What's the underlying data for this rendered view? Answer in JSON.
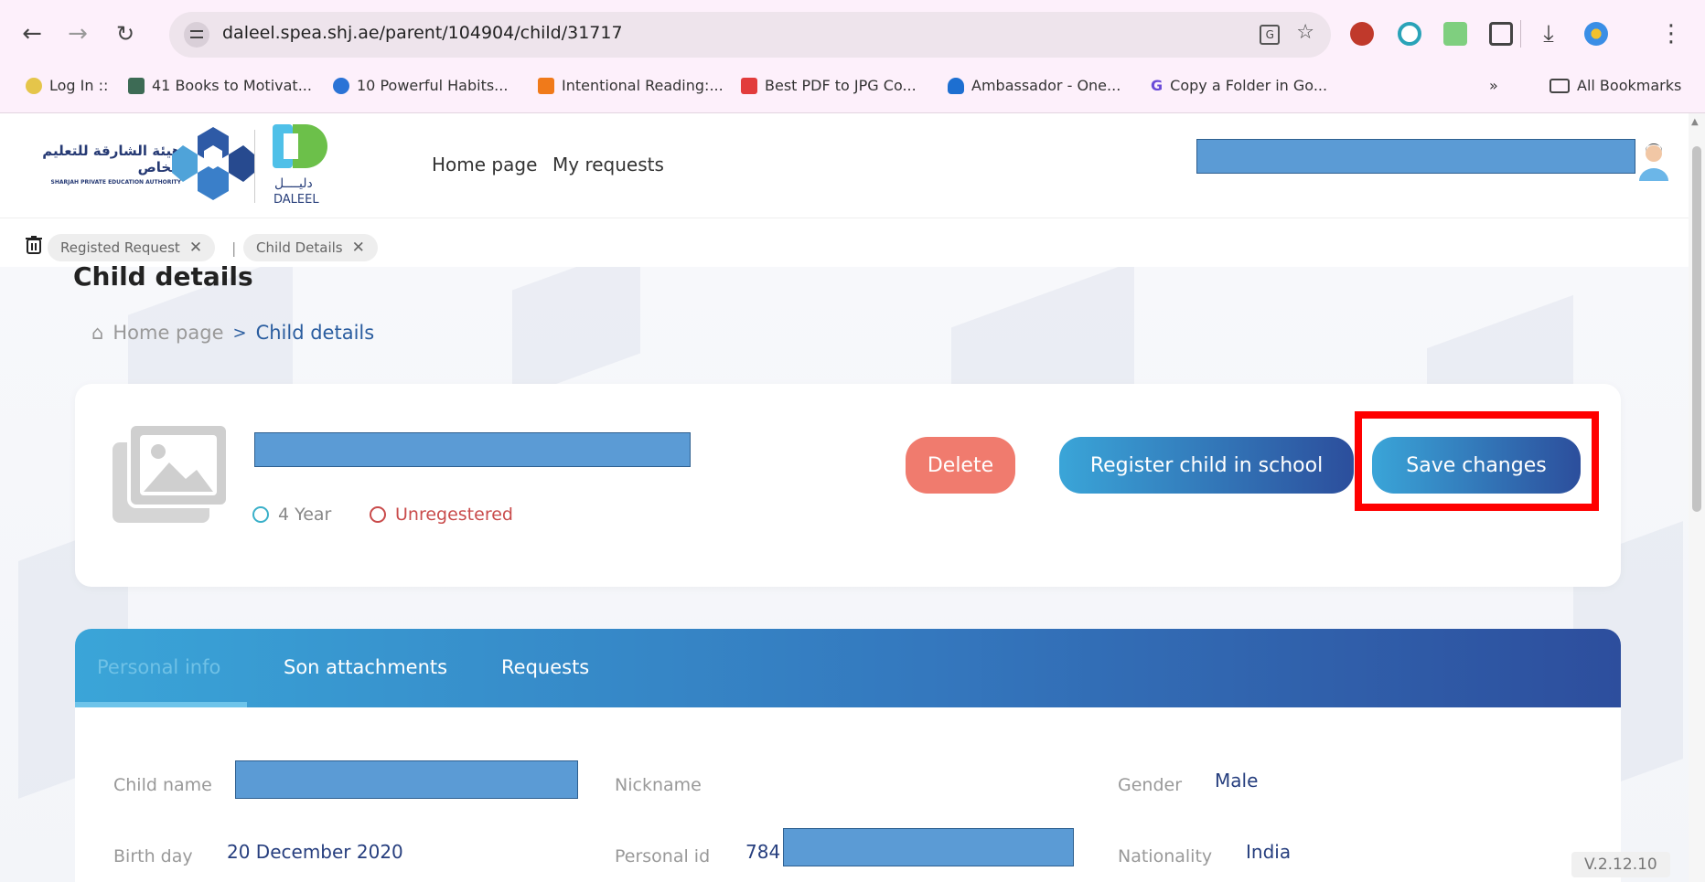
{
  "browser": {
    "url": "daleel.spea.shj.ae/parent/104904/child/31717",
    "bookmarks": [
      "Log In ::",
      "41 Books to Motivat...",
      "10 Powerful Habits...",
      "Intentional Reading:...",
      "Best PDF to JPG Co...",
      "Ambassador - One...",
      "Copy a Folder in Go..."
    ],
    "more_bookmarks": "»",
    "all_bookmarks": "All Bookmarks"
  },
  "header": {
    "spea_arabic": "هيئة الشارقة للتعليم الخاص",
    "spea_english": "SHARJAH PRIVATE EDUCATION AUTHORITY",
    "daleel_arabic": "دليــــل",
    "daleel_english": "DALEEL",
    "nav": [
      "Home page",
      "My requests"
    ]
  },
  "tabs": {
    "items": [
      "Registed Request",
      "Child Details"
    ],
    "separator": "|",
    "close": "✕"
  },
  "page": {
    "title": "Child details",
    "breadcrumb_home": "Home page",
    "breadcrumb_sep": ">",
    "breadcrumb_current": "Child details"
  },
  "child_card": {
    "age": "4 Year",
    "status": "Unregestered",
    "status_color": "#c94b4b",
    "buttons": {
      "delete": "Delete",
      "register": "Register child in school",
      "save": "Save changes"
    }
  },
  "info_tabs": [
    "Personal info",
    "Son attachments",
    "Requests"
  ],
  "fields": {
    "child_name_label": "Child name",
    "nickname_label": "Nickname",
    "gender_label": "Gender",
    "gender_value": "Male",
    "birthday_label": "Birth day",
    "birthday_value": "20 December 2020",
    "personal_id_label": "Personal id",
    "personal_id_value": "784",
    "nationality_label": "Nationality",
    "nationality_value": "India"
  },
  "version": "V.2.12.10",
  "colors": {
    "accent_start": "#3aa5d8",
    "accent_end": "#2c4e9c",
    "delete": "#f07b6e",
    "highlight": "#ff0000",
    "redaction": "#5b9bd5"
  }
}
